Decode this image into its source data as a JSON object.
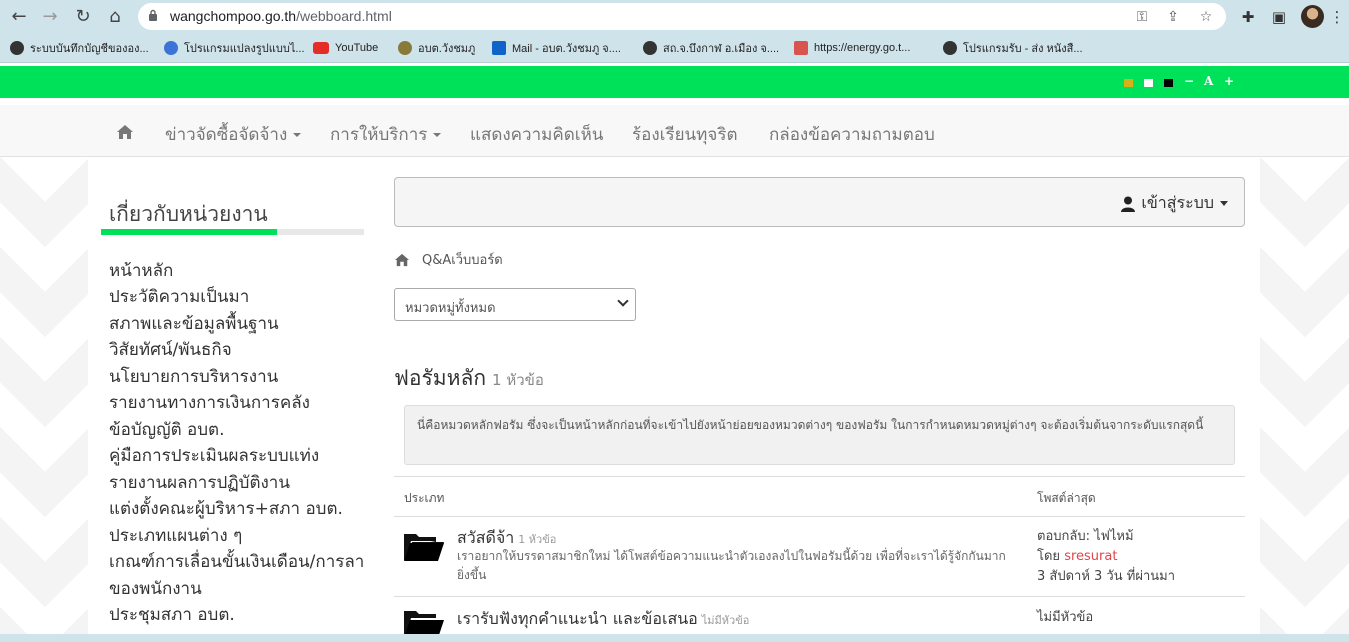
{
  "browser": {
    "url_host": "wangchompoo.go.th",
    "url_path": "/webboard.html",
    "bookmarks": [
      {
        "label": "ระบบบันทึกบัญชีขององ...",
        "color": "#333"
      },
      {
        "label": "โปรแกรมแปลงรูปแบบไ...",
        "color": "#3b73d8"
      },
      {
        "label": "YouTube",
        "color": "#e52d27"
      },
      {
        "label": "อบต.วังชมภู",
        "color": "#8a7a3a"
      },
      {
        "label": "Mail - อบต.วังชมภู จ....",
        "color": "#0f63c9"
      },
      {
        "label": "สถ.จ.บึงกาฬ อ.เมือง จ....",
        "color": "#333"
      },
      {
        "label": "https://energy.go.t...",
        "color": "#d9534f"
      },
      {
        "label": "โปรแกรมรับ - ส่ง หนังสื...",
        "color": "#333"
      }
    ]
  },
  "accessibility": {
    "minus": "−",
    "font": "A",
    "plus": "+"
  },
  "menu": {
    "items": [
      "ข่าวจัดซื้อจัดจ้าง",
      "การให้บริการ",
      "แสดงความคิดเห็น",
      "ร้องเรียนทุจริต",
      "กล่องข้อความถามตอบ"
    ]
  },
  "sidebar": {
    "title": "เกี่ยวกับหน่วยงาน",
    "items": [
      "หน้าหลัก",
      "ประวัติความเป็นมา",
      "สภาพและข้อมูลพื้นฐาน",
      "วิสัยทัศน์/พันธกิจ",
      "นโยบายการบริหารงาน",
      "รายงานทางการเงินการคลัง",
      "ข้อบัญญัติ อบต.",
      "คู่มือการประเมินผลระบบแท่ง",
      "รายงานผลการปฏิบัติงาน",
      "แต่งตั้งคณะผู้บริหาร+สภา อบต.",
      "ประเภทแผนต่าง ๆ",
      "เกณฑ์การเลื่อนขั้นเงินเดือน/การลา",
      "ของพนักงาน",
      "ประชุมสภา อบต."
    ]
  },
  "login": {
    "label": "เข้าสู่ระบบ"
  },
  "breadcrumb": {
    "label": "Q&Aเว็บบอร์ด"
  },
  "category_select": {
    "value": "หมวดหมู่ทั้งหมด"
  },
  "forum": {
    "title": "ฟอรัมหลัก",
    "count": "1 หัวข้อ",
    "description": "นี่คือหมวดหลักฟอรัม ซึ่งจะเป็นหน้าหลักก่อนที่จะเข้าไปยังหน้าย่อยของหมวดต่างๆ ของฟอรัม ในการกำหนดหมวดหมู่ต่างๆ จะต้องเริ่มต้นจากระดับแรกสุดนี้",
    "col_type": "ประเภท",
    "col_latest": "โพสต์ล่าสุด",
    "topics": [
      {
        "title": "สวัสดีจ้า",
        "count": "1 หัวข้อ",
        "desc": "เราอยากให้บรรดาสมาชิกใหม่ ได้โพสต์ข้อความแนะนำตัวเองลงไปในฟอรัมนี้ด้วย เพื่อที่จะเราได้รู้จักกันมากยิ่งขึ้น",
        "last_line1": "ตอบกลับ: ไฟไหม้",
        "last_by": "โดย",
        "last_author": "sresurat",
        "last_time": "3 สัปดาห์ 3 วัน ที่ผ่านมา"
      },
      {
        "title": "เรารับฟังทุกคำแนะนำ และข้อเสนอ",
        "count": "ไม่มีหัวข้อ",
        "desc": "",
        "last_line1": "ไม่มีหัวข้อ"
      }
    ]
  }
}
